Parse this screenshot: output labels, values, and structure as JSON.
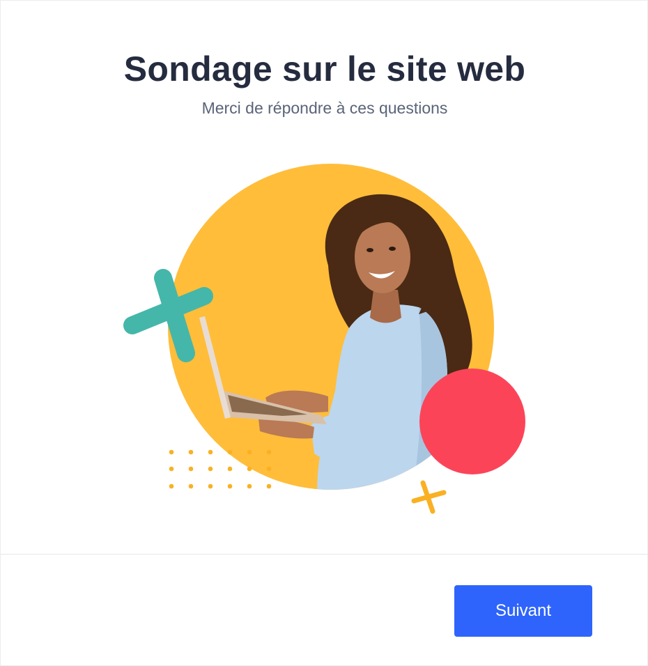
{
  "survey": {
    "title": "Sondage sur le site web",
    "subtitle": "Merci de répondre à ces questions"
  },
  "illustration": {
    "description_icon": "woman-with-laptop-image",
    "colors": {
      "circle_yellow": "#ffbd3a",
      "teal_cross": "#45b6aa",
      "red_circle": "#fc4459",
      "orange_accent": "#f9b123",
      "shirt": "#bcd6ee",
      "hair": "#4a2a14",
      "skin": "#b97a55"
    }
  },
  "footer": {
    "next_label": "Suivant",
    "button_color": "#2e64fb"
  }
}
